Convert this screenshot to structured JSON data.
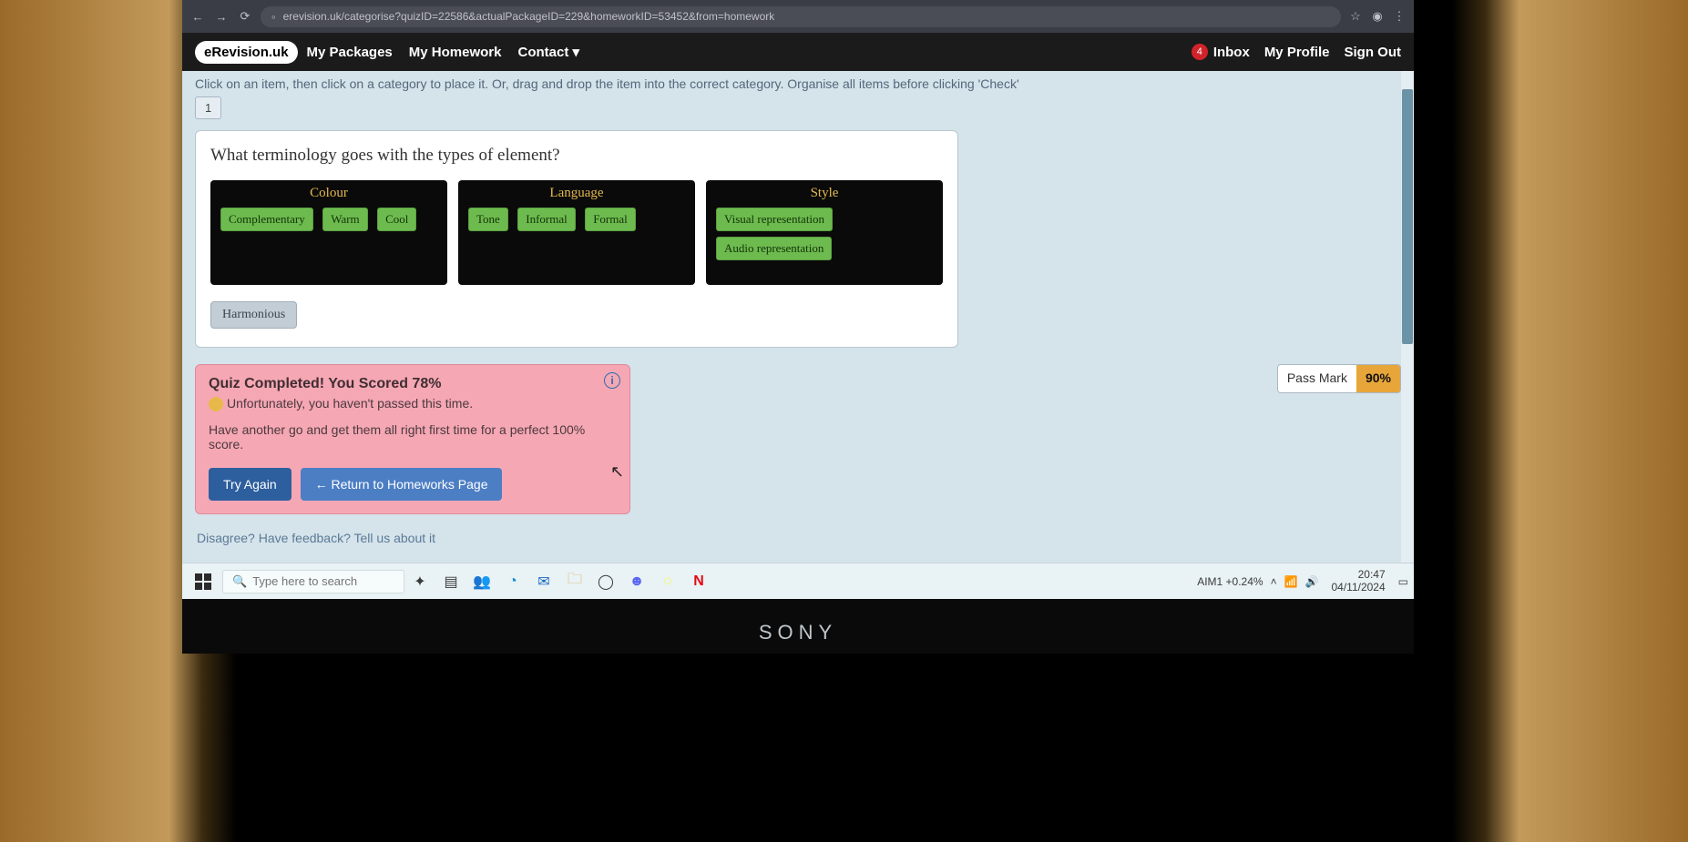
{
  "browser": {
    "url": "erevision.uk/categorise?quizID=22586&actualPackageID=229&homeworkID=53452&from=homework"
  },
  "topbar": {
    "brand": "eRevision.uk",
    "nav": {
      "packages": "My Packages",
      "homework": "My Homework",
      "contact": "Contact"
    },
    "inbox_count": "4",
    "inbox": "Inbox",
    "profile": "My Profile",
    "signout": "Sign Out"
  },
  "instructions": "Click on an item, then click on a category to place it. Or, drag and drop the item into the correct category. Organise all items before clicking 'Check'",
  "qnum": "1",
  "question": "What terminology goes with the types of element?",
  "categories": [
    {
      "title": "Colour",
      "items": [
        "Complementary",
        "Warm",
        "Cool"
      ]
    },
    {
      "title": "Language",
      "items": [
        "Tone",
        "Informal",
        "Formal"
      ]
    },
    {
      "title": "Style",
      "items": [
        "Visual representation",
        "Audio representation"
      ]
    }
  ],
  "leftover": [
    "Harmonious"
  ],
  "result": {
    "title": "Quiz Completed! You Scored 78%",
    "line1": "Unfortunately, you haven't passed this time.",
    "line2": "Have another go and get them all right first time for a perfect 100% score.",
    "try_again": "Try Again",
    "return": "←  Return to Homeworks Page"
  },
  "passmark": {
    "label": "Pass Mark",
    "value": "90%"
  },
  "feedback": "Disagree? Have feedback? Tell us about it",
  "taskbar": {
    "search_placeholder": "Type here to search",
    "stock": "AIM1  +0.24%",
    "time": "20:47",
    "date": "04/11/2024"
  },
  "bezel": "SONY"
}
